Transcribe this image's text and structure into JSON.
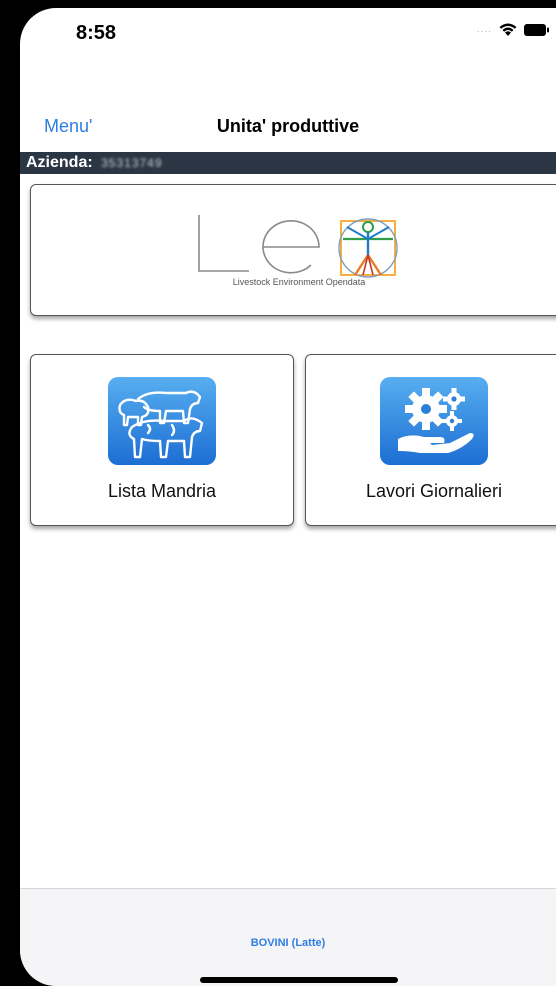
{
  "status_bar": {
    "time": "8:58",
    "signal_dots": "....",
    "icons": [
      "wifi-icon",
      "battery-icon"
    ]
  },
  "nav": {
    "back_label": "Menu'",
    "title": "Unita' produttive"
  },
  "azienda": {
    "label": "Azienda:",
    "value": "35313749"
  },
  "logo": {
    "letters": "Le",
    "caption": "Livestock Environment Opendata",
    "icon": "vitruvian-man-icon"
  },
  "tiles": [
    {
      "label": "Lista Mandria",
      "icon": "livestock-icon"
    },
    {
      "label": "Lavori Giornalieri",
      "icon": "gears-hand-icon"
    }
  ],
  "tab_bar": {
    "active_label": "BOVINI (Latte)"
  },
  "colors": {
    "accent_blue": "#2f7de1",
    "header_bar": "#2b3644",
    "tile_icon_top": "#58aef0",
    "tile_icon_bottom": "#1c6ed3"
  }
}
